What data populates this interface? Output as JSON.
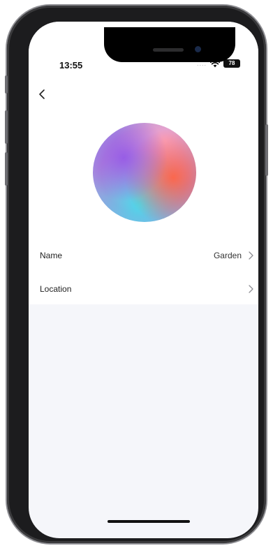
{
  "status_bar": {
    "time": "13:55",
    "signal": "....",
    "battery": "78"
  },
  "header": {
    "back_icon": "chevron-left-icon"
  },
  "device": {
    "image": "gradient-orb-icon"
  },
  "settings": [
    {
      "label": "Name",
      "value": "Garden",
      "icon": "chevron-right-icon"
    },
    {
      "label": "Location",
      "value": "",
      "icon": "chevron-right-icon"
    }
  ],
  "colors": {
    "background": "#f5f6fa",
    "card": "#ffffff",
    "text": "#222222",
    "chevron": "#8e8e93"
  }
}
